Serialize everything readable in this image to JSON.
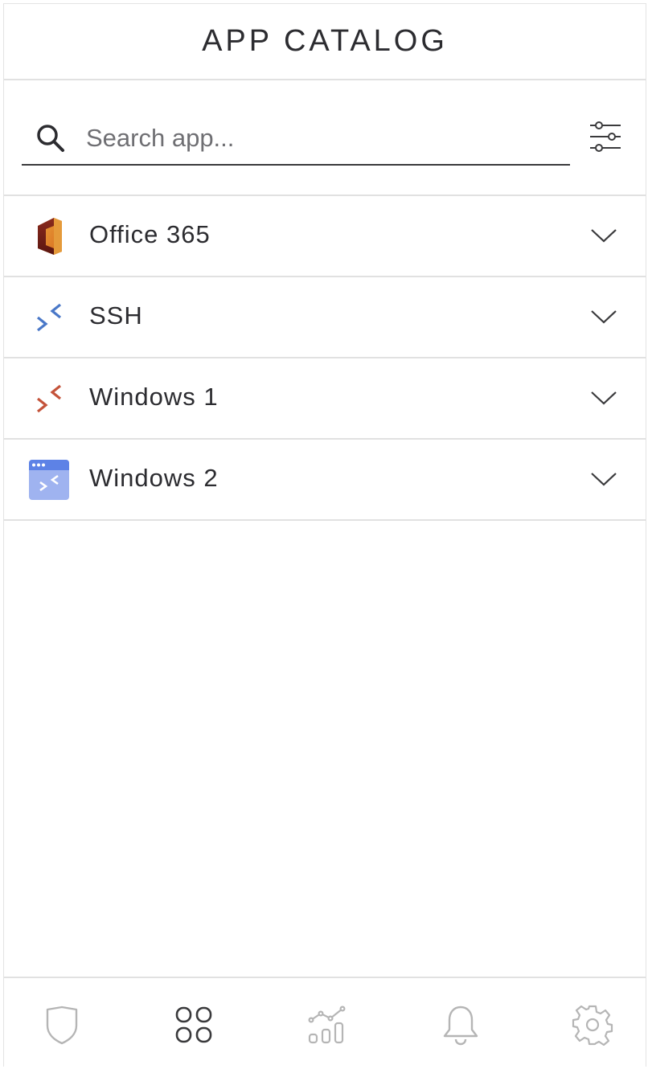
{
  "header": {
    "title": "APP CATALOG"
  },
  "search": {
    "placeholder": "Search app...",
    "value": ""
  },
  "apps": [
    {
      "name": "Office 365",
      "icon": "office-365-icon"
    },
    {
      "name": "SSH",
      "icon": "remote-connect-blue-icon"
    },
    {
      "name": "Windows 1",
      "icon": "remote-connect-orange-icon"
    },
    {
      "name": "Windows 2",
      "icon": "remote-window-icon"
    }
  ],
  "bottom_nav": {
    "items": [
      {
        "name": "shield",
        "icon": "shield-icon",
        "active": false
      },
      {
        "name": "apps",
        "icon": "apps-grid-icon",
        "active": true
      },
      {
        "name": "analytics",
        "icon": "analytics-icon",
        "active": false
      },
      {
        "name": "notifications",
        "icon": "bell-icon",
        "active": false
      },
      {
        "name": "settings",
        "icon": "gear-icon",
        "active": false
      }
    ]
  },
  "colors": {
    "text": "#2c2c30",
    "divider": "#e1e1e1",
    "nav_inactive": "#b5b5b5",
    "nav_active": "#3a3a3c",
    "ssh_blue": "#4a78c8",
    "windows_orange": "#c4533a",
    "window_icon_bg": "#9fb3f0"
  }
}
